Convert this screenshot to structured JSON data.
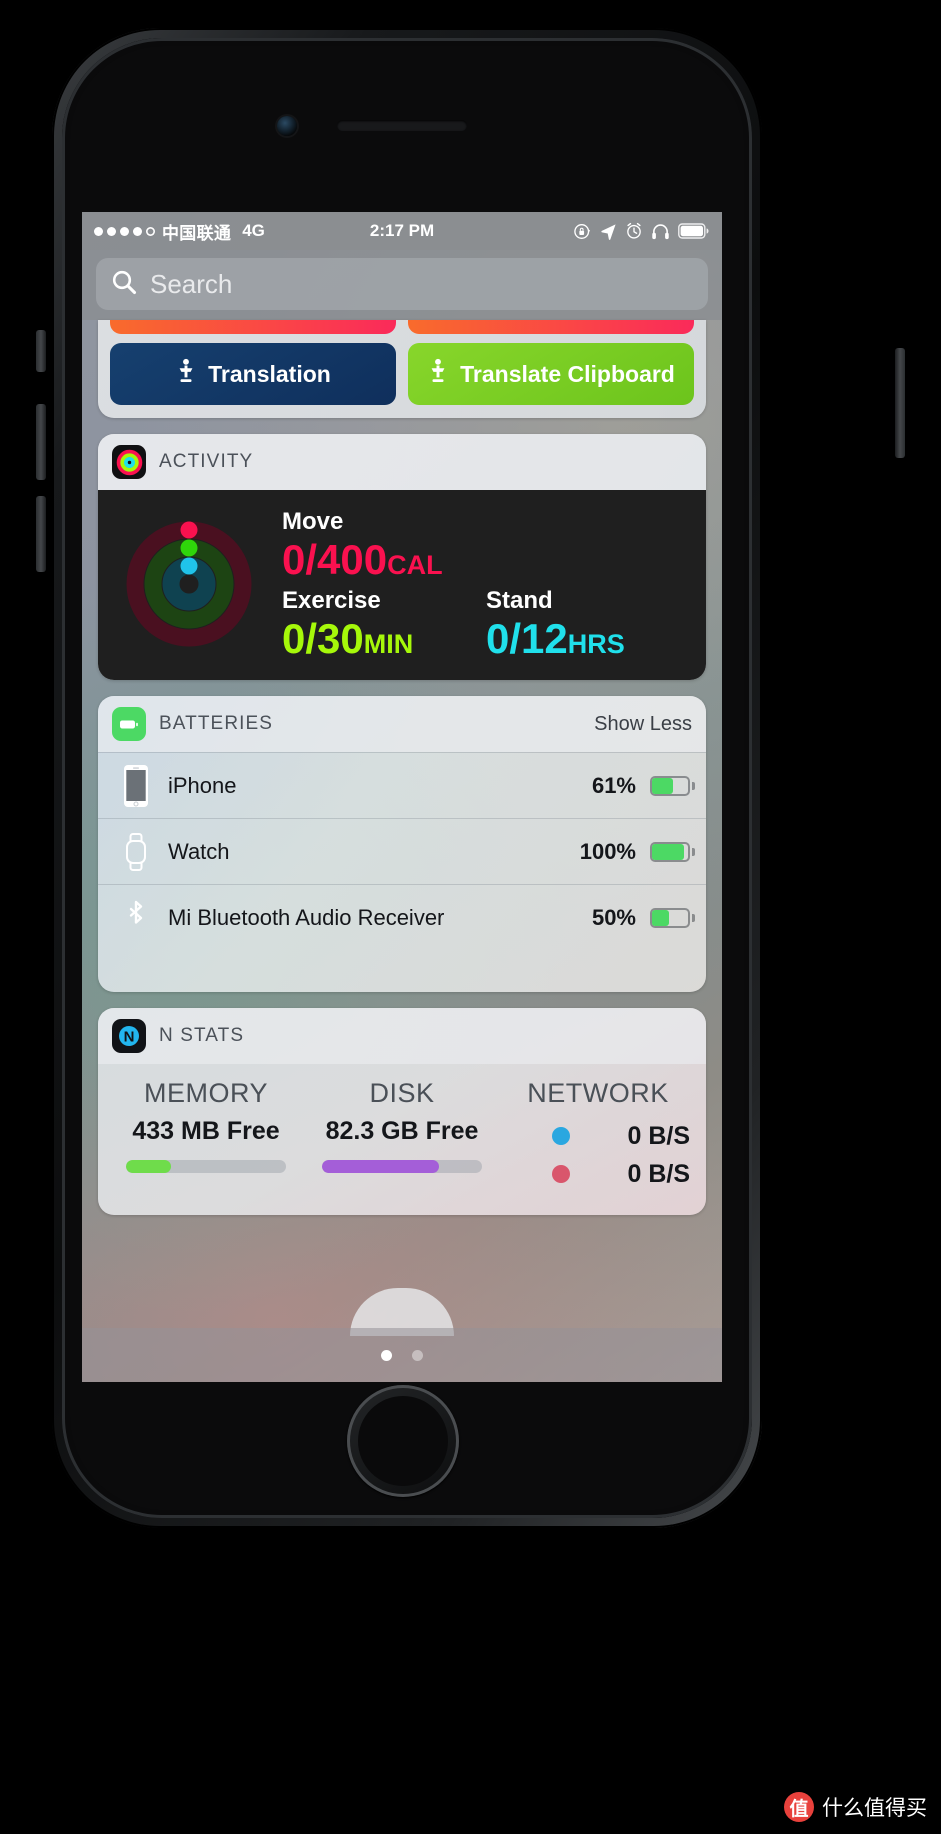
{
  "status_bar": {
    "signal_dots_filled": 4,
    "signal_dots_total": 5,
    "carrier": "中国联通",
    "network": "4G",
    "time": "2:17 PM",
    "icons": [
      "rotation-lock-icon",
      "location-arrow-icon",
      "alarm-clock-icon",
      "headphones-icon",
      "battery-icon"
    ]
  },
  "search": {
    "placeholder": "Search",
    "icon": "search-icon"
  },
  "widgets": {
    "translate": {
      "buttons": [
        {
          "label": "Translation",
          "color": "#16406f",
          "icon": "translate-icon"
        },
        {
          "label": "Translate Clipboard",
          "color": "#7ccd23",
          "icon": "translate-icon"
        }
      ]
    },
    "activity": {
      "title": "ACTIVITY",
      "icon": "activity-rings-icon",
      "move": {
        "label": "Move",
        "value": "0/400",
        "unit": "CAL",
        "color": "#fa114f"
      },
      "exercise": {
        "label": "Exercise",
        "value": "0/30",
        "unit": "MIN",
        "color": "#a6f80a"
      },
      "stand": {
        "label": "Stand",
        "value": "0/12",
        "unit": "HRS",
        "color": "#20e0eb"
      }
    },
    "batteries": {
      "title": "BATTERIES",
      "icon": "battery-app-icon",
      "action": "Show Less",
      "rows": [
        {
          "name": "iPhone",
          "percent": "61%",
          "level": 61,
          "icon": "iphone-icon"
        },
        {
          "name": "Watch",
          "percent": "100%",
          "level": 100,
          "icon": "watch-icon"
        },
        {
          "name": "Mi Bluetooth Audio Receiver",
          "percent": "50%",
          "level": 50,
          "icon": "bluetooth-icon"
        }
      ]
    },
    "nstats": {
      "title": "N STATS",
      "icon": "n-stats-icon",
      "memory": {
        "header": "MEMORY",
        "value": "433 MB Free",
        "bar_percent": 28,
        "bar_color": "#6fdc4b"
      },
      "disk": {
        "header": "DISK",
        "value": "82.3 GB Free",
        "bar_percent": 73,
        "bar_color": "#a45ed8"
      },
      "network": {
        "header": "NETWORK",
        "rows": [
          {
            "value": "0 B/S",
            "dot_color": "#2aa7e0"
          },
          {
            "value": "0 B/S",
            "dot_color": "#d9566c"
          }
        ]
      }
    }
  },
  "page_indicator": {
    "pages": 2,
    "active": 0
  },
  "watermark": {
    "badge": "值",
    "text": "什么值得买"
  }
}
